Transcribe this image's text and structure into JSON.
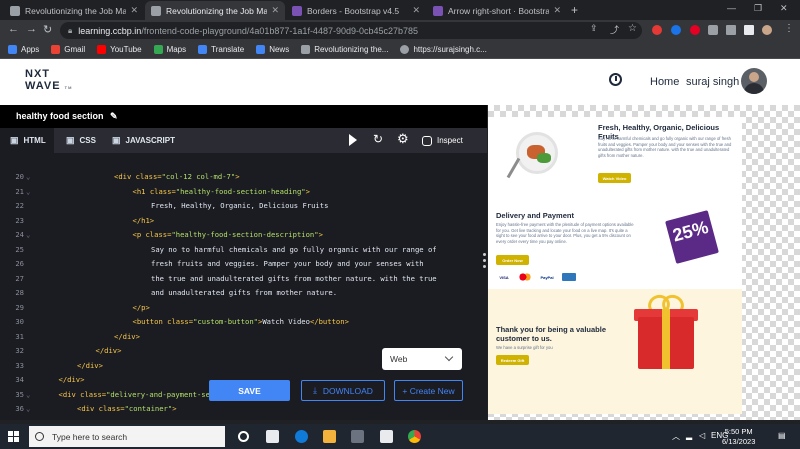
{
  "browser": {
    "tabs": [
      {
        "title": "Revolutionizing the Job Market |",
        "active": false,
        "favicon_color": "#9aa0a6"
      },
      {
        "title": "Revolutionizing the Job Market |",
        "active": true,
        "favicon_color": "#9aa0a6"
      },
      {
        "title": "Borders - Bootstrap v4.5",
        "active": false,
        "favicon_color": "#7952b3"
      },
      {
        "title": "Arrow right-short · Bootstrap Ico",
        "active": false,
        "favicon_color": "#7952b3"
      }
    ],
    "url_host": "learning.ccbp.in",
    "url_path": "/frontend-code-playground/4a01b877-1a1f-4487-90d9-0cb45c27b785",
    "bookmarks": [
      {
        "label": "Apps",
        "color": "#4285f4"
      },
      {
        "label": "Gmail",
        "color": "#ea4335"
      },
      {
        "label": "YouTube",
        "color": "#ff0000"
      },
      {
        "label": "Maps",
        "color": "#34a853"
      },
      {
        "label": "Translate",
        "color": "#4285f4"
      },
      {
        "label": "News",
        "color": "#4285f4"
      },
      {
        "label": "Revolutionizing the...",
        "color": "#9aa0a6"
      },
      {
        "label": "https://surajsingh.c...",
        "color": "#9aa0a6"
      }
    ]
  },
  "site": {
    "logo_line1": "NXT",
    "logo_line2": "WAVE",
    "logo_tm": "TM",
    "home": "Home",
    "username": "suraj singh"
  },
  "editor": {
    "project_title": "healthy food section",
    "tabs": {
      "html": "HTML",
      "css": "CSS",
      "js": "JAVASCRIPT"
    },
    "inspect": "Inspect",
    "lines": [
      {
        "n": "20",
        "fold": true,
        "indent": 4,
        "parts": [
          [
            "t-tag",
            "<div "
          ],
          [
            "t-attr",
            "class="
          ],
          [
            "t-val",
            "\"col-12 col-md-7\""
          ],
          [
            "t-tag",
            ">"
          ]
        ]
      },
      {
        "n": "21",
        "fold": true,
        "indent": 5,
        "parts": [
          [
            "t-tag",
            "<h1 "
          ],
          [
            "t-attr",
            "class="
          ],
          [
            "t-val",
            "\"healthy-food-section-heading\""
          ],
          [
            "t-tag",
            ">"
          ]
        ]
      },
      {
        "n": "22",
        "fold": false,
        "indent": 6,
        "parts": [
          [
            "t-txt",
            "Fresh, Healthy, Organic, Delicious Fruits"
          ]
        ]
      },
      {
        "n": "23",
        "fold": false,
        "indent": 5,
        "parts": [
          [
            "t-tag",
            "</h1>"
          ]
        ]
      },
      {
        "n": "24",
        "fold": true,
        "indent": 5,
        "parts": [
          [
            "t-tag",
            "<p "
          ],
          [
            "t-attr",
            "class="
          ],
          [
            "t-val",
            "\"healthy-food-section-description\""
          ],
          [
            "t-tag",
            ">"
          ]
        ]
      },
      {
        "n": "25",
        "fold": false,
        "indent": 6,
        "parts": [
          [
            "t-txt",
            "Say no to harmful chemicals and go fully organic with our range of"
          ]
        ]
      },
      {
        "n": "26",
        "fold": false,
        "indent": 6,
        "parts": [
          [
            "t-txt",
            "fresh fruits and veggies. Pamper your body and your senses with"
          ]
        ]
      },
      {
        "n": "27",
        "fold": false,
        "indent": 6,
        "parts": [
          [
            "t-txt",
            "the true and unadulterated gifts from mother nature. with the true"
          ]
        ]
      },
      {
        "n": "28",
        "fold": false,
        "indent": 6,
        "parts": [
          [
            "t-txt",
            "and unadulterated gifts from mother nature."
          ]
        ]
      },
      {
        "n": "29",
        "fold": false,
        "indent": 5,
        "parts": [
          [
            "t-tag",
            "</p>"
          ]
        ]
      },
      {
        "n": "30",
        "fold": false,
        "indent": 5,
        "parts": [
          [
            "t-tag",
            "<button "
          ],
          [
            "t-attr",
            "class="
          ],
          [
            "t-val",
            "\"custom-button\""
          ],
          [
            "t-tag",
            ">"
          ],
          [
            "t-txt",
            "Watch Video"
          ],
          [
            "t-tag",
            "</button>"
          ]
        ]
      },
      {
        "n": "31",
        "fold": false,
        "indent": 4,
        "parts": [
          [
            "t-tag",
            "</div>"
          ]
        ]
      },
      {
        "n": "32",
        "fold": false,
        "indent": 3,
        "parts": [
          [
            "t-tag",
            "</div>"
          ]
        ]
      },
      {
        "n": "33",
        "fold": false,
        "indent": 2,
        "parts": [
          [
            "t-tag",
            "</div>"
          ]
        ]
      },
      {
        "n": "34",
        "fold": false,
        "indent": 1,
        "parts": [
          [
            "t-tag",
            "</div>"
          ]
        ]
      },
      {
        "n": "35",
        "fold": true,
        "indent": 1,
        "parts": [
          [
            "t-tag",
            "<div "
          ],
          [
            "t-attr",
            "class="
          ],
          [
            "t-val",
            "\"delivery-and-payment-se"
          ]
        ]
      },
      {
        "n": "36",
        "fold": true,
        "indent": 2,
        "parts": [
          [
            "t-tag",
            "<div "
          ],
          [
            "t-attr",
            "class="
          ],
          [
            "t-val",
            "\"container\""
          ],
          [
            "t-tag",
            ">"
          ]
        ]
      }
    ],
    "view_select": "Web",
    "save": "SAVE",
    "download": "DOWNLOAD",
    "create_new": "+ Create New"
  },
  "preview": {
    "s1_heading": "Fresh, Healthy, Organic, Delicious Fruits",
    "s1_desc": "Say no to harmful chemicals and go fully organic with our range of fresh fruits and veggies. Pamper your body and your senses with the true and unadulterated gifts from mother nature. with the true and unadulterated gifts from mother nature.",
    "s1_button": "Watch Video",
    "s2_heading": "Delivery and Payment",
    "s2_desc": "Enjoy hassle-free payment with the plenitude of payment options available for you. Get live tracking and locate your food on a live map. It's quite a sight to see your food arrive to your door. Plus, you get a 5% discount on every order every time you pay online.",
    "s2_button": "Order Now",
    "promo_pct": "25%",
    "promo_off": "OFF",
    "cards": [
      "VISA",
      "",
      "PayPal",
      ""
    ],
    "s3_heading": "Thank you for being a valuable customer to us.",
    "s3_desc": "We have a surprise gift for you",
    "s3_button": "Redeem Gift"
  },
  "taskbar": {
    "search_placeholder": "Type here to search",
    "language": "ENG",
    "time": "5:50 PM",
    "date": "6/13/2023"
  }
}
